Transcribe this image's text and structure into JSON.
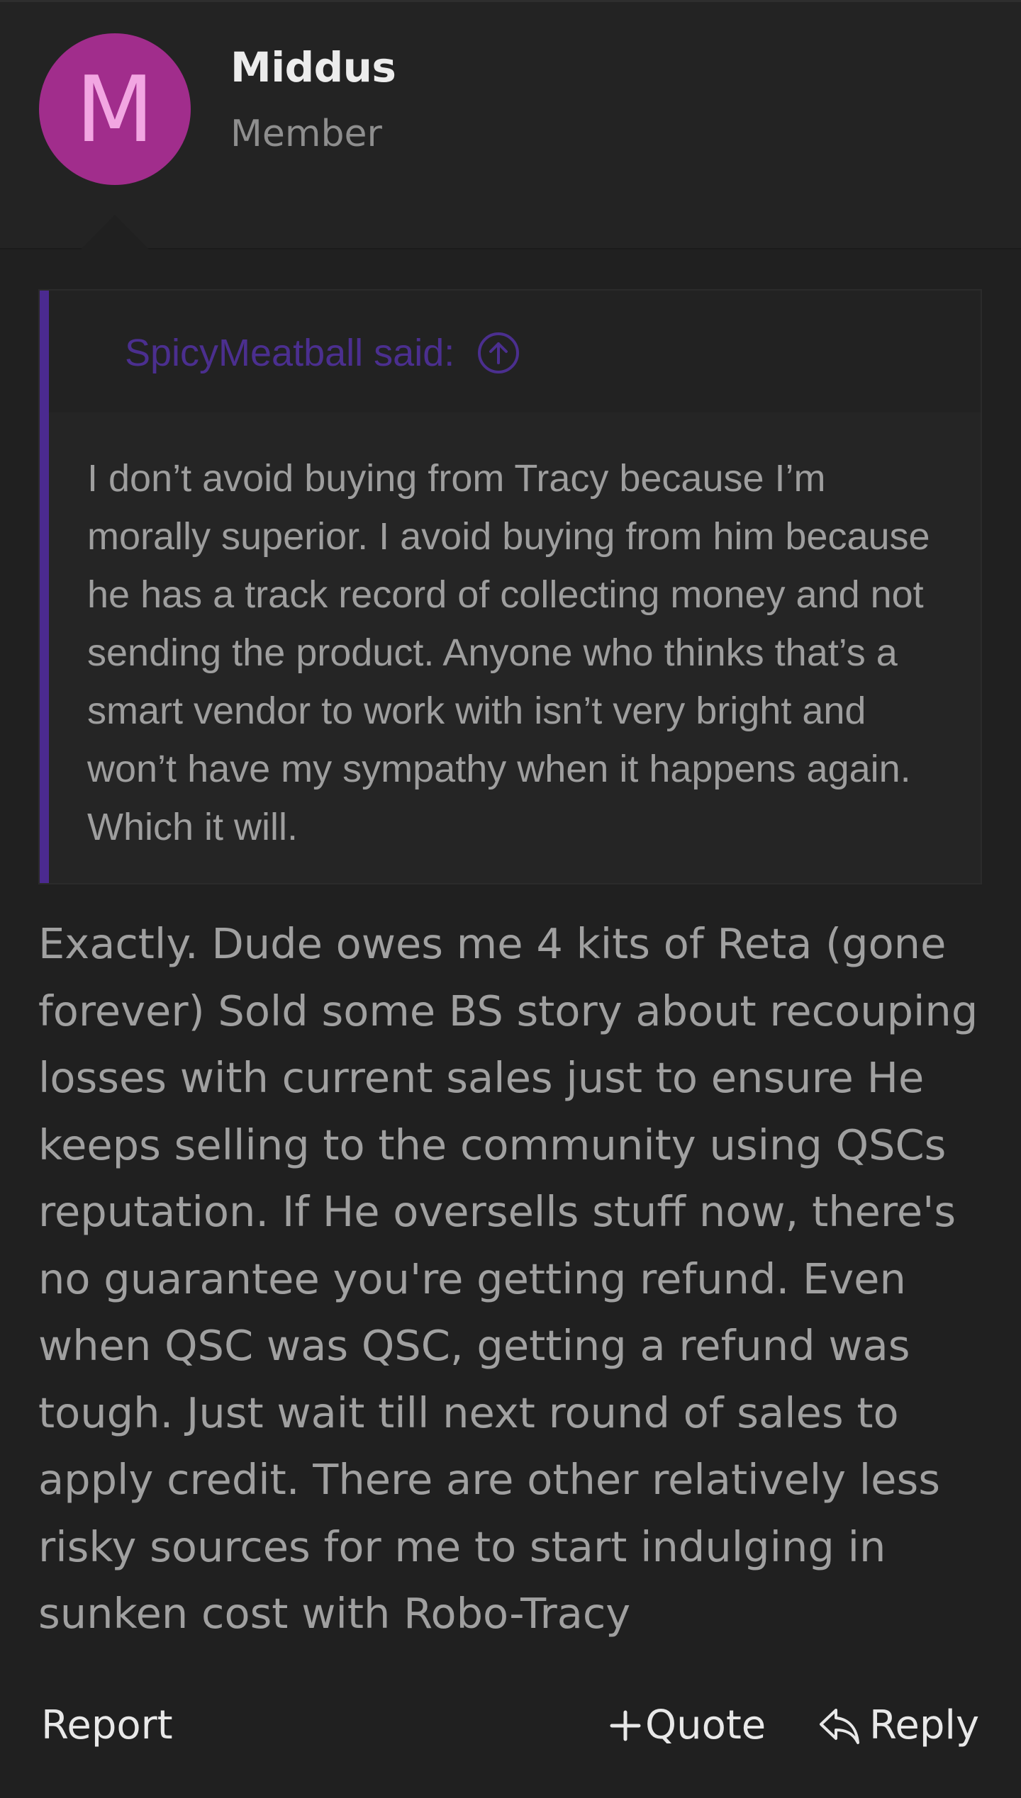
{
  "post": {
    "avatar_letter": "M",
    "avatar_color": "#a12d8c",
    "username": "Middus",
    "user_title": "Member"
  },
  "quote": {
    "author_label": "SpicyMeatball said:",
    "accent_color": "#4b2a90",
    "jump_icon": "arrow-up-circle-icon",
    "body": "I don’t avoid buying from Tracy because I’m morally superior. I avoid buying from him because he has a track record of collecting money and not sending the product. Anyone who thinks that’s a smart vendor to work with isn’t very bright and won’t have my sympathy when it happens again. Which it will."
  },
  "message": {
    "body": "Exactly. Dude owes me 4 kits of Reta (gone forever) Sold some BS story about recouping losses with current sales just to ensure He keeps selling to the community using QSCs reputation. If He oversells stuff now, there's no guarantee you're getting refund. Even when QSC was QSC, getting a refund was tough. Just wait till next round of sales to apply credit. There are other relatively less risky sources for me to start indulging in sunken cost with Robo-Tracy"
  },
  "actions": {
    "report_label": "Report",
    "quote_label": "Quote",
    "quote_icon": "plus-icon",
    "reply_label": "Reply",
    "reply_icon": "reply-arrow-icon"
  }
}
